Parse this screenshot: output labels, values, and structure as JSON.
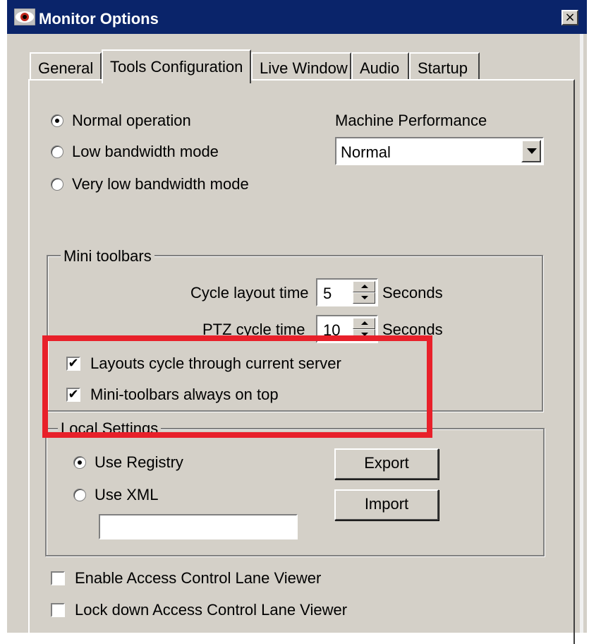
{
  "window": {
    "title": "Monitor Options",
    "close_label": "×"
  },
  "tabs": [
    {
      "label": "General",
      "active": false
    },
    {
      "label": "Tools Configuration",
      "active": true
    },
    {
      "label": "Live Window",
      "active": false
    },
    {
      "label": "Audio",
      "active": false
    },
    {
      "label": "Startup",
      "active": false
    }
  ],
  "operation": {
    "options": [
      {
        "label": "Normal operation",
        "selected": true
      },
      {
        "label": "Low bandwidth mode",
        "selected": false
      },
      {
        "label": "Very low bandwidth mode",
        "selected": false
      }
    ]
  },
  "performance": {
    "label": "Machine Performance",
    "selected": "Normal"
  },
  "mini_toolbars": {
    "title": "Mini toolbars",
    "cycle_layout_label": "Cycle layout time",
    "cycle_layout_value": "5",
    "cycle_layout_unit": "Seconds",
    "ptz_cycle_label": "PTZ cycle time",
    "ptz_cycle_value": "10",
    "ptz_cycle_unit": "Seconds",
    "layouts_cycle_label": "Layouts cycle through current server",
    "layouts_cycle_checked": true,
    "always_on_top_label": "Mini-toolbars always on top",
    "always_on_top_checked": true
  },
  "local_settings": {
    "title": "Local Settings",
    "use_registry_label": "Use Registry",
    "use_registry_selected": true,
    "use_xml_label": "Use XML",
    "use_xml_selected": false,
    "export_label": "Export",
    "import_label": "Import",
    "xml_path_value": ""
  },
  "access_control": {
    "enable_label": "Enable Access Control Lane Viewer",
    "enable_checked": false,
    "lock_label": "Lock down Access Control Lane Viewer",
    "lock_checked": false
  },
  "colors": {
    "titlebar": "#0a246a",
    "dialog_face": "#d4d0c8",
    "highlight": "#e8202a"
  },
  "icons": {
    "title_icon": "eye-icon",
    "checkmark": "✔"
  }
}
